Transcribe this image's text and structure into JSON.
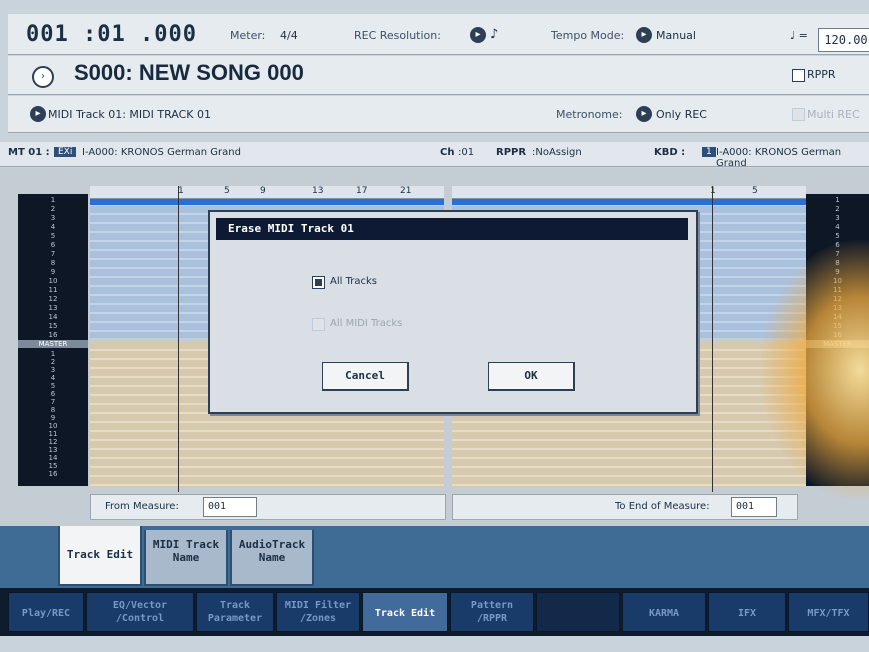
{
  "header": {
    "position": "001 :01 .000",
    "meter_label": "Meter:",
    "meter_value": "4/4",
    "rec_resolution_label": "REC Resolution:",
    "rec_resolution_value": "♪",
    "tempo_mode_label": "Tempo Mode:",
    "tempo_mode_value": "Manual",
    "tempo_symbol": "♩ =",
    "tempo_value": "120.00"
  },
  "song": {
    "title": "S000: NEW SONG 000",
    "rppr_label": "RPPR"
  },
  "track_row": {
    "track_label": "MIDI Track 01: MIDI TRACK 01",
    "metronome_label": "Metronome:",
    "metronome_value": "Only REC",
    "multi_rec_label": "Multi REC"
  },
  "info_bar": {
    "track_id": "MT 01 :",
    "exi_badge": "EXi",
    "program": "I-A000: KRONOS German Grand",
    "ch_label": "Ch",
    "ch_value": ":01",
    "rppr_label": "RPPR",
    "rppr_value": ":NoAssign",
    "kbd_label": "KBD :",
    "kbd_badge": "1",
    "kbd_program": "I-A000: KRONOS German Grand"
  },
  "ruler_left": [
    "1",
    "5",
    "9",
    "13",
    "17",
    "21"
  ],
  "ruler_right": [
    "1",
    "5"
  ],
  "track_numbers_top": [
    "1",
    "2",
    "3",
    "4",
    "5",
    "6",
    "7",
    "8",
    "9",
    "10",
    "11",
    "12",
    "13",
    "14",
    "15",
    "16"
  ],
  "master_label": "MASTER",
  "track_numbers_bottom": [
    "1",
    "2",
    "3",
    "4",
    "5",
    "6",
    "7",
    "8",
    "9",
    "10",
    "11",
    "12",
    "13",
    "14",
    "15",
    "16"
  ],
  "from_measure": {
    "label": "From Measure:",
    "value": "001"
  },
  "to_measure": {
    "label": "To End of Measure:",
    "value": "001"
  },
  "dialog": {
    "title": "Erase MIDI Track 01",
    "option_all_tracks": "All Tracks",
    "option_all_midi_tracks": "All MIDI Tracks",
    "cancel": "Cancel",
    "ok": "OK"
  },
  "sub_tabs": [
    {
      "line1": "Track Edit",
      "line2": ""
    },
    {
      "line1": "MIDI Track",
      "line2": "Name"
    },
    {
      "line1": "AudioTrack",
      "line2": "Name"
    }
  ],
  "main_tabs": [
    {
      "line1": "Play/REC",
      "line2": ""
    },
    {
      "line1": "EQ/Vector",
      "line2": "/Control"
    },
    {
      "line1": "Track",
      "line2": "Parameter"
    },
    {
      "line1": "MIDI Filter",
      "line2": "/Zones"
    },
    {
      "line1": "Track Edit",
      "line2": ""
    },
    {
      "line1": "Pattern",
      "line2": "/RPPR"
    },
    {
      "line1": "",
      "line2": ""
    },
    {
      "line1": "KARMA",
      "line2": ""
    },
    {
      "line1": "IFX",
      "line2": ""
    },
    {
      "line1": "MFX/TFX",
      "line2": ""
    }
  ]
}
